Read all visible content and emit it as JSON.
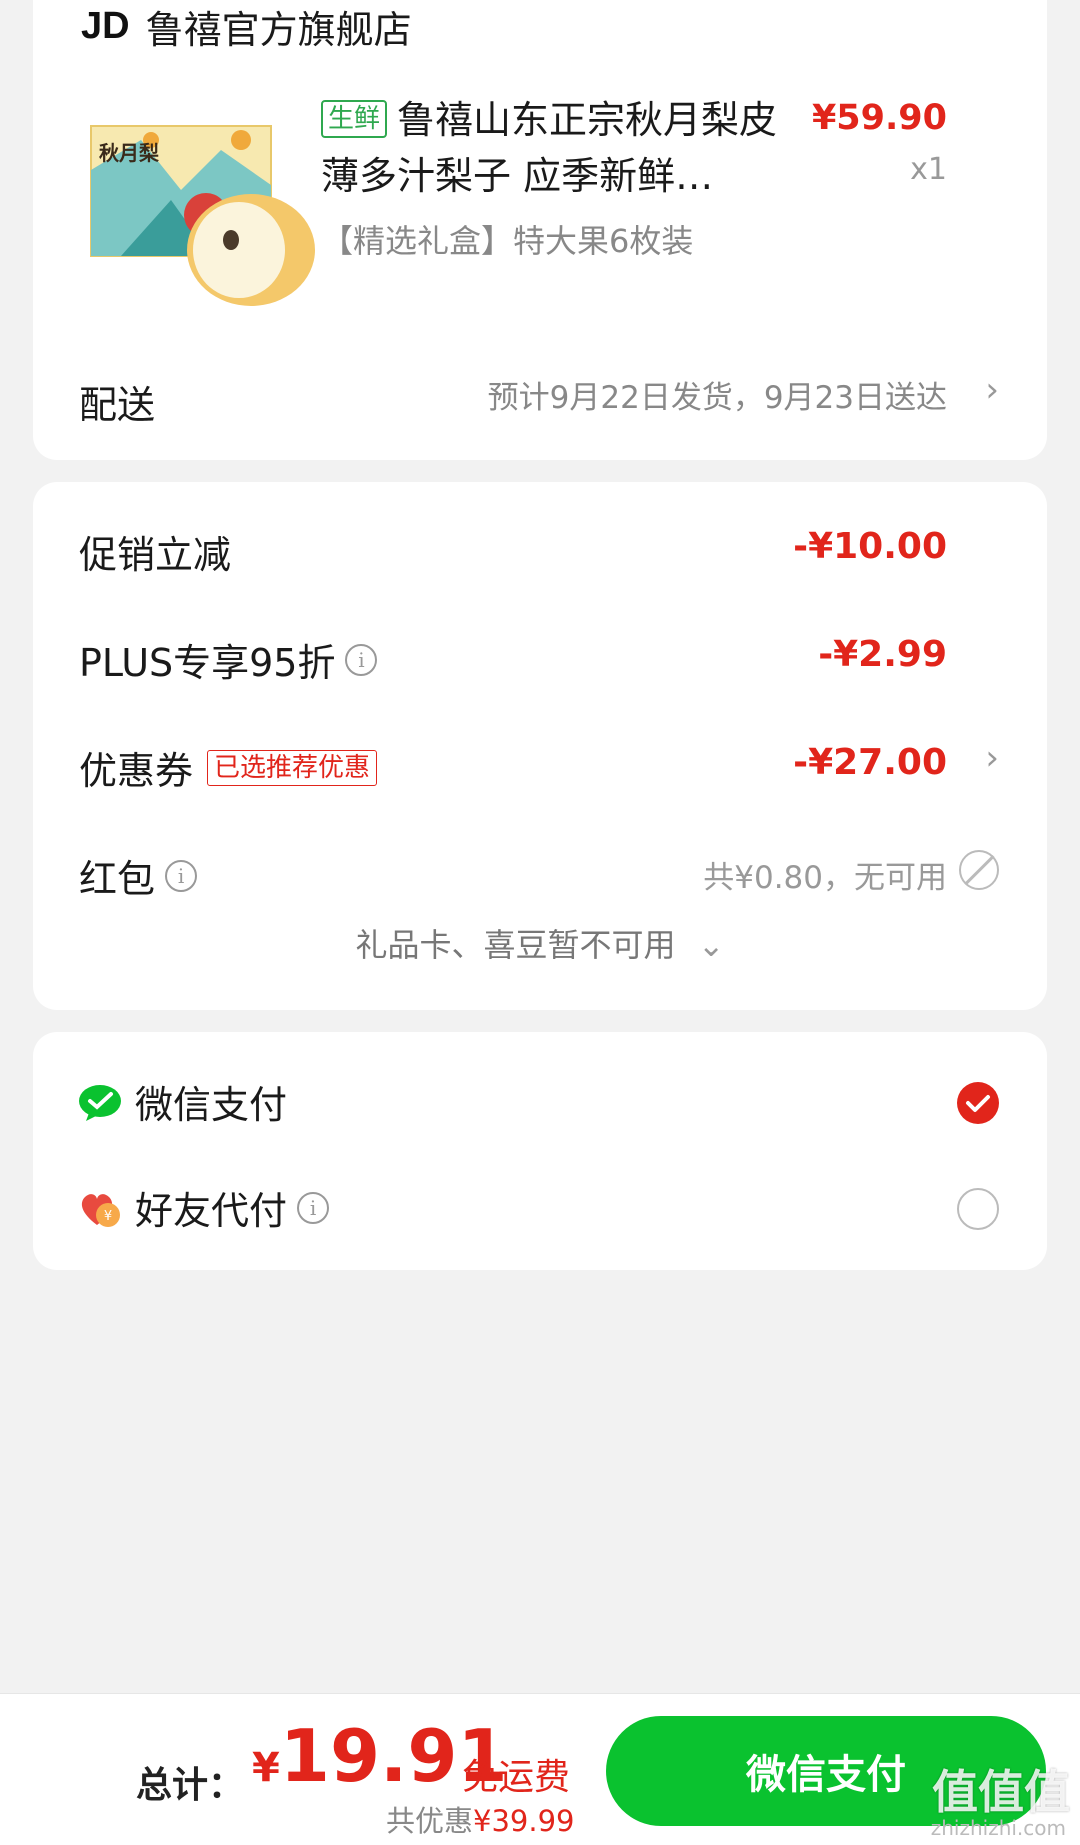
{
  "shop": {
    "logo": "JD",
    "name": "鲁禧官方旗舰店"
  },
  "product": {
    "tag": "生鲜",
    "title": "鲁禧山东正宗秋月梨皮薄多汁梨子 应季新鲜…",
    "box_label": "秋月梨",
    "price": "¥59.90",
    "quantity": "x1",
    "spec": "【精选礼盒】特大果6枚装"
  },
  "delivery": {
    "label": "配送",
    "info": "预计9月22日发货，9月23日送达"
  },
  "discounts": {
    "promo": {
      "label": "促销立减",
      "value": "-¥10.00"
    },
    "plus": {
      "label": "PLUS专享95折",
      "value": "-¥2.99"
    },
    "coupon": {
      "label": "优惠券",
      "tag": "已选推荐优惠",
      "value": "-¥27.00"
    },
    "hongbao": {
      "label": "红包",
      "note": "共¥0.80，无可用"
    },
    "gift_note": "礼品卡、喜豆暂不可用"
  },
  "payment": {
    "wechat": {
      "label": "微信支付",
      "selected": true
    },
    "friend": {
      "label": "好友代付",
      "selected": false
    }
  },
  "footer": {
    "total_label": "总计：",
    "currency": "¥",
    "total": "19.91",
    "free_shipping": "免运费",
    "saved_label": "共优惠",
    "saved_amount": "¥39.99",
    "pay_button": "微信支付",
    "watermark": "值值值",
    "watermark_sub": "zhizhizhi.com"
  },
  "colors": {
    "price_red": "#e1251b",
    "wechat_green": "#0ac22f",
    "fresh_green": "#2fa84f"
  },
  "icons": {
    "info": "info-icon",
    "chevron": "chevron-right-icon",
    "disabled": "disabled-icon",
    "wechat": "wechat-icon",
    "friend_pay": "friend-pay-icon"
  }
}
